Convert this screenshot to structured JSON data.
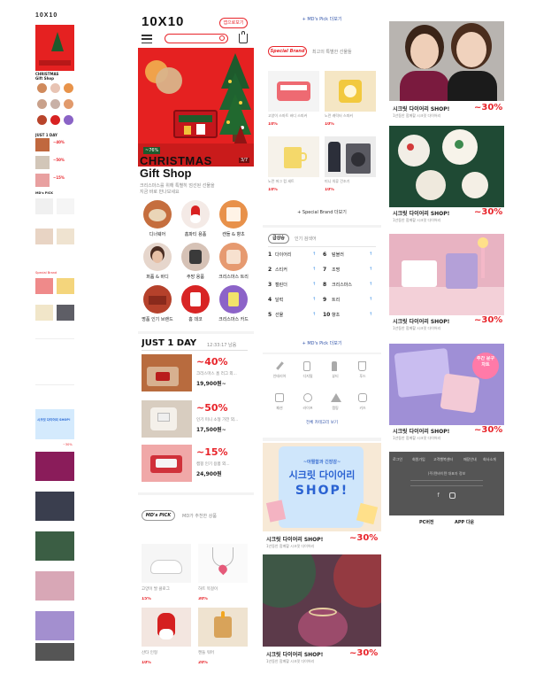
{
  "mini": {
    "logo": "10X10",
    "christmas": "CHRISTMAS",
    "gift_shop": "Gift Shop",
    "just1day": "JUST 1 DAY",
    "sale1": "~40%",
    "sale2": "~50%",
    "sale3": "~15%",
    "md_pick": "MD's PICK",
    "special": "Special Brand",
    "label_a": "MD's Pick 더보기",
    "label_b": "Special Brand 더보기",
    "diary_shop": "시크릿 다이어리 SHOP!",
    "pct": "~30%"
  },
  "main": {
    "logo": "10X10",
    "app_btn": "앱으로보기",
    "banner": {
      "line1": "CHRISTMAS",
      "line2": "Gift Shop",
      "desc1": "크리스마스를 위해 특별히 엄선된 선물을",
      "desc2": "지금 바로 만나보세요",
      "badge": "~76%",
      "page": "3/7"
    },
    "categories": [
      {
        "label": "디너웨어"
      },
      {
        "label": "홈파티 용품"
      },
      {
        "label": "캔들 & 향초"
      },
      {
        "label": "퍼퓸 & 바디"
      },
      {
        "label": "주방 용품"
      },
      {
        "label": "크리스마스 트리"
      },
      {
        "label": "명품 인기 브랜드"
      },
      {
        "label": "홈 데코"
      },
      {
        "label": "크리스마스 카드"
      }
    ],
    "just1day": {
      "title": "JUST 1 DAY",
      "timer": "12:33:17 남음",
      "items": [
        {
          "pct": "~40%",
          "desc": "크리스마스 홈 러그 외...",
          "price": "19,900원~"
        },
        {
          "pct": "~50%",
          "desc": "인기 미니 소형 가전 외...",
          "price": "17,500원~"
        },
        {
          "pct": "~15%",
          "desc": "캠핑 인기 용품 외...",
          "price": "24,900원"
        }
      ]
    },
    "md_pick": {
      "title": "MD's PICK",
      "sub": "MD가 추천한 상품",
      "items": [
        {
          "name": "고양이 발 클로그",
          "pct": "15%"
        },
        {
          "name": "하트 목걸이",
          "pct": "30%"
        },
        {
          "name": "산타 인형",
          "pct": "10%"
        },
        {
          "name": "캔들 워머",
          "pct": "20%"
        }
      ]
    }
  },
  "col3": {
    "md_more": "+ MD's Pick 더보기",
    "special": {
      "tag": "Special Brand",
      "sub": "최고의 특별한 선물들",
      "more": "+ Special Brand 더보기",
      "items": [
        {
          "name": "고양이 스마트 바디 스피커",
          "pct": "10%"
        },
        {
          "name": "노란 캐릭터 스피커",
          "pct": "10%"
        },
        {
          "name": "노란 머그 컵 세트",
          "pct": "10%"
        },
        {
          "name": "미니 의류 건조기",
          "pct": "10%"
        }
      ]
    },
    "ranking": {
      "tab1": "급상승",
      "tab2": "인기 검색어",
      "more": "+ MD's Pick 더보기",
      "left": [
        {
          "n": "1",
          "w": "다이어리"
        },
        {
          "n": "2",
          "w": "스티커"
        },
        {
          "n": "3",
          "w": "캘린더"
        },
        {
          "n": "4",
          "w": "달력"
        },
        {
          "n": "5",
          "w": "선물"
        }
      ],
      "right": [
        {
          "n": "6",
          "w": "텀블러"
        },
        {
          "n": "7",
          "w": "조명"
        },
        {
          "n": "8",
          "w": "크리스마스"
        },
        {
          "n": "9",
          "w": "트리"
        },
        {
          "n": "10",
          "w": "향초"
        }
      ]
    },
    "quick": [
      "인테리어",
      "디지털",
      "뷰티",
      "푸드",
      "패션",
      "라이프",
      "캠핑",
      "키즈"
    ],
    "quick_more": "전체 카테고리 보기",
    "diary": {
      "line1": "~아찔함과 긴장감~",
      "line2": "시크릿 다이어리",
      "line3": "SHOP!",
      "title": "시크릿 다이어리 SHOP!",
      "sub": "1년동안 함께할 시크릿 다이어리",
      "pct": "~30%"
    },
    "diary2": {
      "title": "시크릿 다이어리 SHOP!",
      "sub": "1년동안 함께할 시크릿 다이어리",
      "pct": "~30%"
    }
  },
  "col4": {
    "cards": [
      {
        "title": "시크릿 다이어리 SHOP!",
        "sub": "1년동안 함께할 시크릿 다이어리",
        "pct": "~30%"
      },
      {
        "title": "시크릿 다이어리 SHOP!",
        "sub": "1년동안 함께할 시크릿 다이어리",
        "pct": "~30%"
      },
      {
        "title": "시크릿 다이어리 SHOP!",
        "sub": "1년동안 함께할 시크릿 다이어리",
        "pct": "~30%"
      },
      {
        "title": "시크릿 다이어리 SHOP!",
        "sub": "1년동안 함께할 시크릿 다이어리",
        "pct": "~30%"
      }
    ],
    "footer": {
      "links": [
        "로그인",
        "회원가입",
        "고객행복센터",
        "매장안내",
        "회사소개"
      ],
      "info": "(주)텐바이텐 대표자 정보",
      "pc": "PC버전",
      "app": "APP 다운"
    }
  },
  "colors": {
    "accent": "#e8242a",
    "banner": "#e52121",
    "footer": "#555555"
  }
}
